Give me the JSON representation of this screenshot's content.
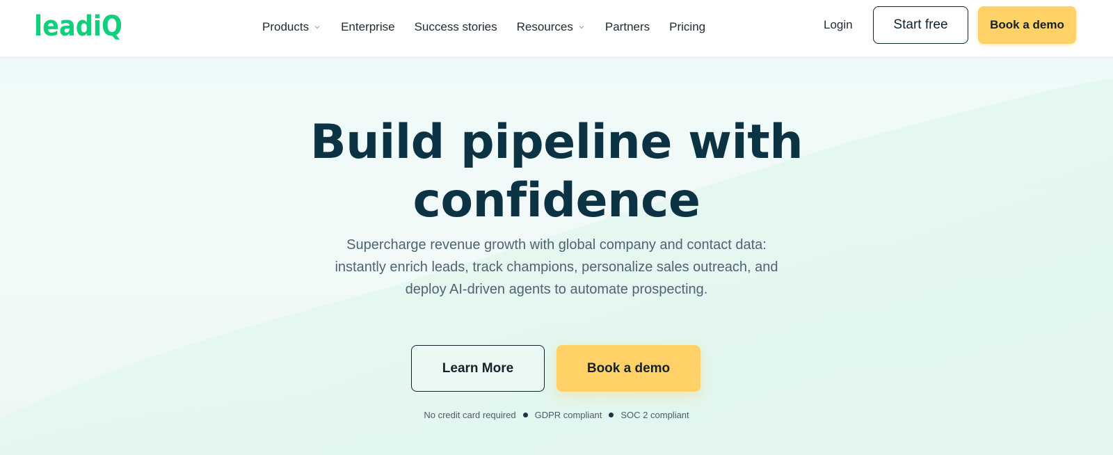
{
  "brand": {
    "logo_text": "leadiQ",
    "color": "#11cf7b"
  },
  "header": {
    "nav": [
      {
        "label": "Products",
        "has_dropdown": true
      },
      {
        "label": "Enterprise",
        "has_dropdown": false
      },
      {
        "label": "Success stories",
        "has_dropdown": false
      },
      {
        "label": "Resources",
        "has_dropdown": true
      },
      {
        "label": "Partners",
        "has_dropdown": false
      },
      {
        "label": "Pricing",
        "has_dropdown": false
      }
    ],
    "login_label": "Login",
    "start_free_label": "Start free",
    "book_demo_label": "Book a demo"
  },
  "hero": {
    "headline_line1": "Build pipeline with",
    "headline_line2": "confidence",
    "subhead": "Supercharge revenue growth with global company and contact data: instantly enrich leads, track champions, personalize sales outreach, and deploy AI-driven agents to automate prospecting.",
    "learn_more_label": "Learn More",
    "book_demo_label": "Book a demo",
    "badges": [
      "No credit card required",
      "GDPR compliant",
      "SOC 2 compliant"
    ]
  },
  "colors": {
    "headline": "#0c3344",
    "accent_button": "#ffd166",
    "hero_background": "#eefaf9"
  },
  "icons": {
    "nav_dropdown": "chevron-down-icon"
  }
}
